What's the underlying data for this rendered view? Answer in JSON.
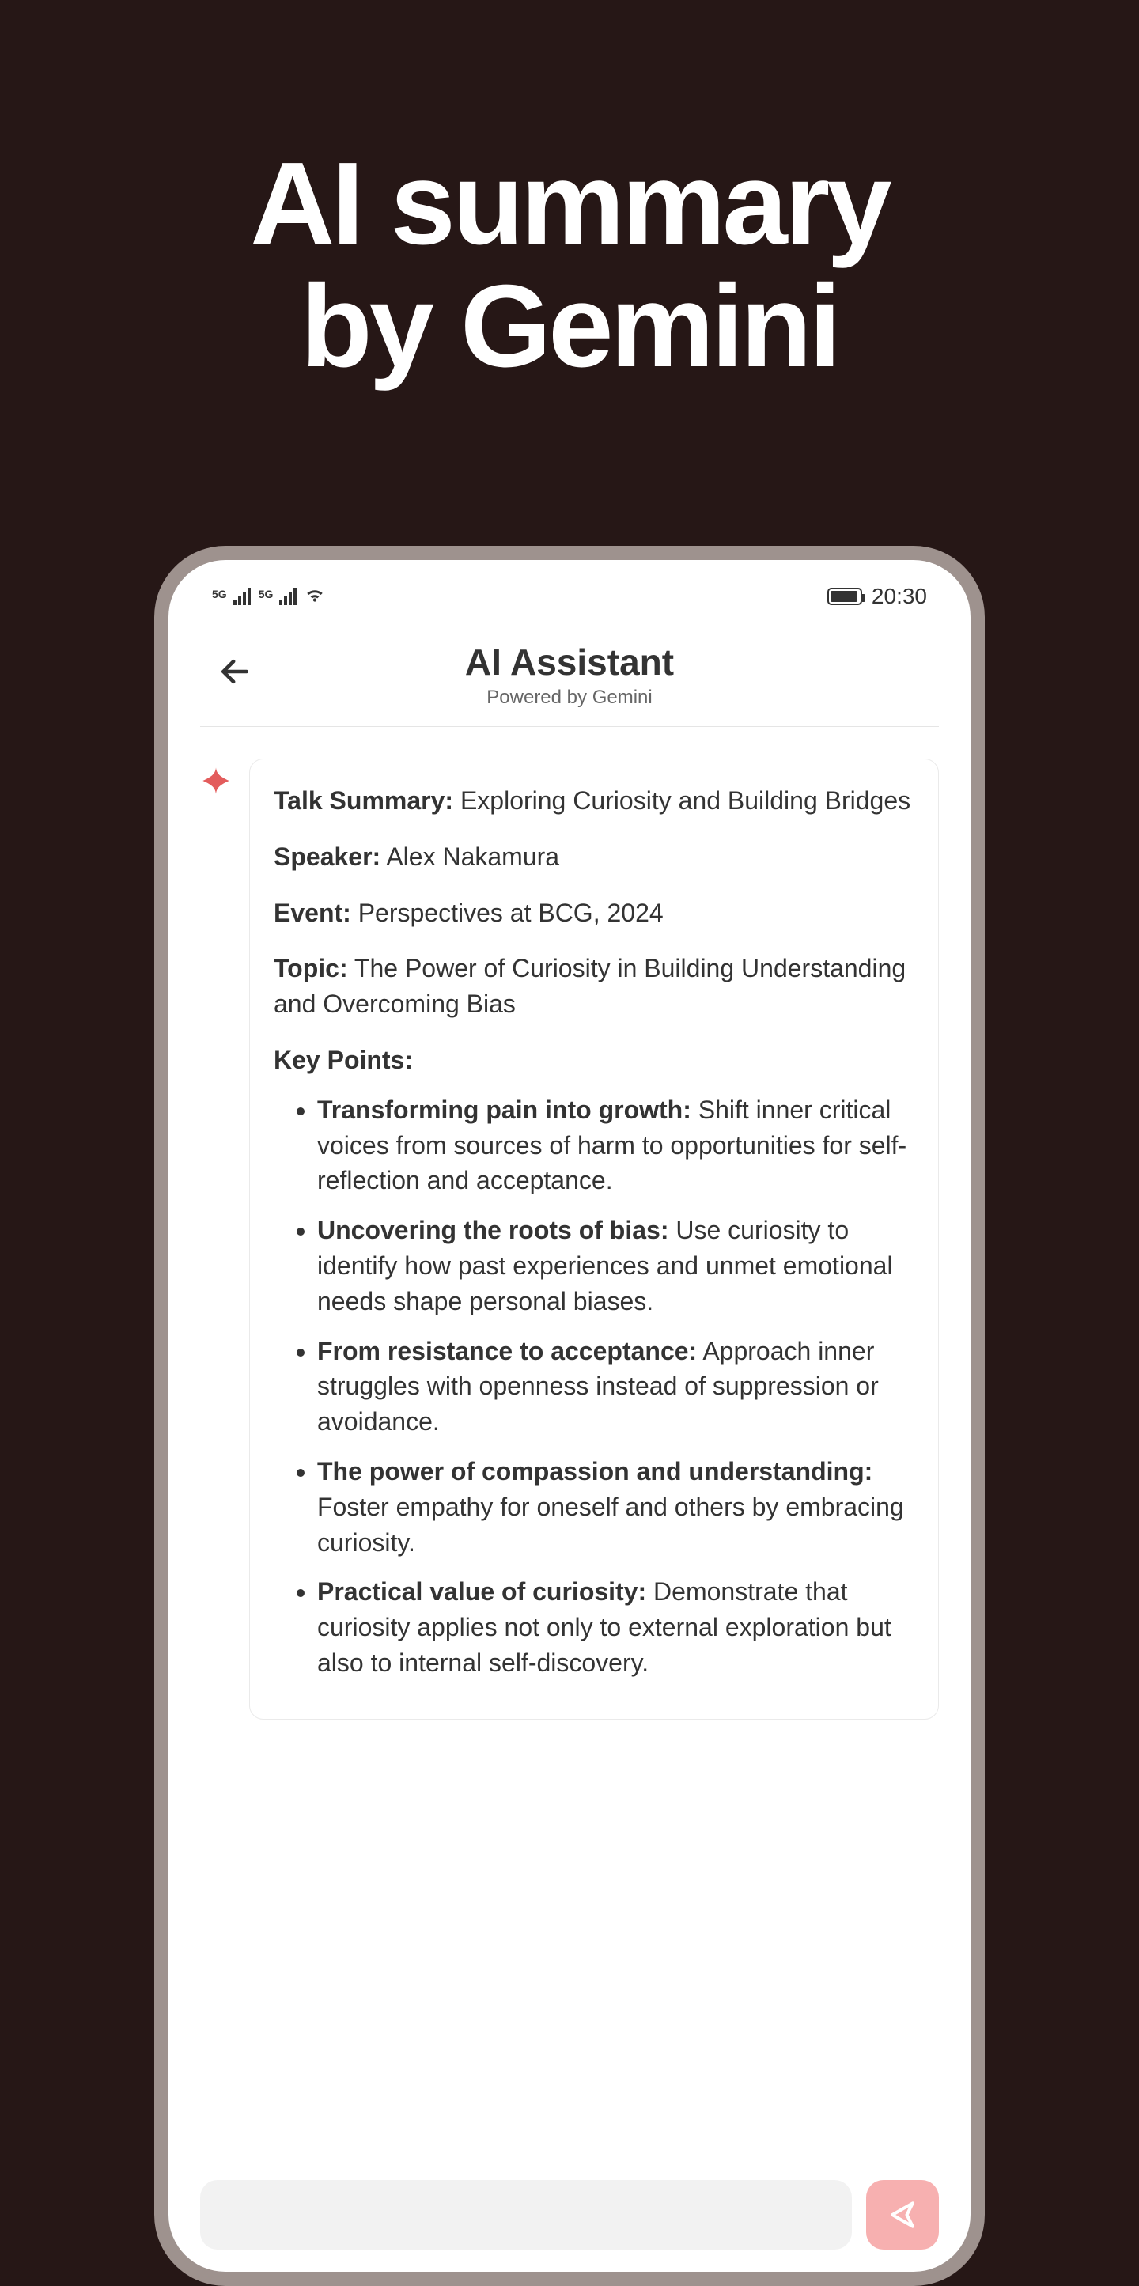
{
  "hero": {
    "line1": "AI summary",
    "line2": "by Gemini"
  },
  "status_bar": {
    "network_label_1": "5G",
    "network_label_2": "5G",
    "clock": "20:30"
  },
  "header": {
    "title": "AI Assistant",
    "subtitle": "Powered by Gemini"
  },
  "summary": {
    "talk_summary_label": "Talk Summary:",
    "talk_summary_value": "Exploring Curiosity and Building Bridges",
    "speaker_label": "Speaker:",
    "speaker_value": "Alex Nakamura",
    "event_label": "Event:",
    "event_value": "Perspectives at BCG, 2024",
    "topic_label": "Topic:",
    "topic_value": "The Power of Curiosity in Building Understanding and Overcoming Bias",
    "key_points_label": "Key Points:",
    "key_points": [
      {
        "title": "Transforming pain into growth:",
        "body": "Shift inner critical voices from sources of harm to opportunities for self-reflection and acceptance."
      },
      {
        "title": "Uncovering the roots of bias:",
        "body": "Use curiosity to identify how past experiences and unmet emotional needs shape personal biases."
      },
      {
        "title": "From resistance to acceptance:",
        "body": "Approach inner struggles with openness instead of suppression or avoidance."
      },
      {
        "title": "The power of compassion and understanding:",
        "body": "Foster empathy for oneself and others by embracing curiosity."
      },
      {
        "title": "Practical value of curiosity:",
        "body": "Demonstrate that curiosity applies not only to external exploration but also to internal self-discovery."
      }
    ]
  },
  "input": {
    "placeholder": ""
  }
}
